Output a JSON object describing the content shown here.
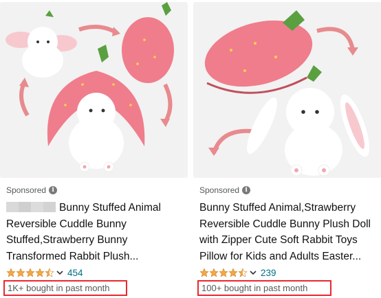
{
  "products": [
    {
      "sponsored_label": "Sponsored",
      "info_icon": "info-icon",
      "title": "Bunny Stuffed Animal Reversible Cuddle Bunny Stuffed,Strawberry Bunny Transformed Rabbit Plush...",
      "rating": 4.5,
      "review_count": "454",
      "bought_text": "1K+ bought in past month"
    },
    {
      "sponsored_label": "Sponsored",
      "info_icon": "info-icon",
      "title": "Bunny Stuffed Animal,Strawberry Reversible Cuddle Bunny Plush Doll with Zipper Cute Soft Rabbit Toys Pillow for Kids and Adults Easter...",
      "rating": 4.5,
      "review_count": "239",
      "bought_text": "100+ bought in past month"
    }
  ],
  "colors": {
    "star": "#f3a847",
    "link": "#007185",
    "highlight_box": "#e8282f",
    "strawberry": "#f07d8c",
    "leaf": "#5aa040"
  }
}
